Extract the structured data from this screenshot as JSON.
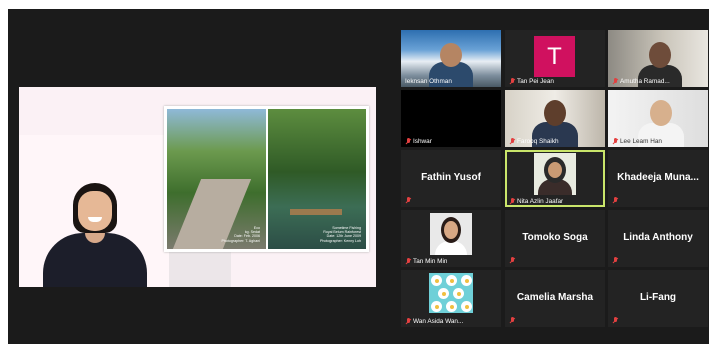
{
  "meeting": {
    "slide_captions": {
      "left": [
        "Eco",
        "kg. Sedat",
        "Date: Feb. 2006",
        "Photographer: T. Aghani"
      ],
      "right": [
        "Sometime Fishing",
        "Royal Belum Rainforest",
        "Date: 12th June 2009",
        "Photographer: Kenny Loh"
      ]
    }
  },
  "participants": [
    {
      "name": "Ieknsan Othman",
      "label": "Ieknsan Othman",
      "muted": false
    },
    {
      "name": "Tan Pei Jean",
      "label": "Tan Pei Jean",
      "muted": true,
      "initial": "T"
    },
    {
      "name": "Amutha Ramad...",
      "label": "Amutha Ramad...",
      "muted": true
    },
    {
      "name": "Ishwar",
      "label": "Ishwar",
      "muted": true
    },
    {
      "name": "Farooq Shaikh",
      "label": "Farooq Shaikh",
      "muted": true
    },
    {
      "name": "Lee Leam Han",
      "label": "Lee Leam Han",
      "muted": true
    },
    {
      "name": "Fathin Yusof",
      "muted": true
    },
    {
      "name": "Nita Azlin Jaafar",
      "label": "Nita Azlin Jaafar",
      "muted": true,
      "active": true
    },
    {
      "name": "Khadeeja Muna...",
      "muted": true
    },
    {
      "name": "Tan Min Min",
      "label": "Tan Min Min",
      "muted": true
    },
    {
      "name": "Tomoko Soga",
      "muted": true
    },
    {
      "name": "Linda Anthony",
      "muted": true
    },
    {
      "name": "Wan Asida Wan...",
      "label": "Wan Asida Wan...",
      "muted": true
    },
    {
      "name": "Camelia Marsha",
      "muted": true
    },
    {
      "name": "Li-Fang",
      "muted": true
    }
  ],
  "colors": {
    "background": "#1b1b1b",
    "tile": "#232323",
    "active_speaker_border": "#c9e56a",
    "muted_icon": "#e34040",
    "avatar_tan_pei_jean": "#d0115f"
  }
}
